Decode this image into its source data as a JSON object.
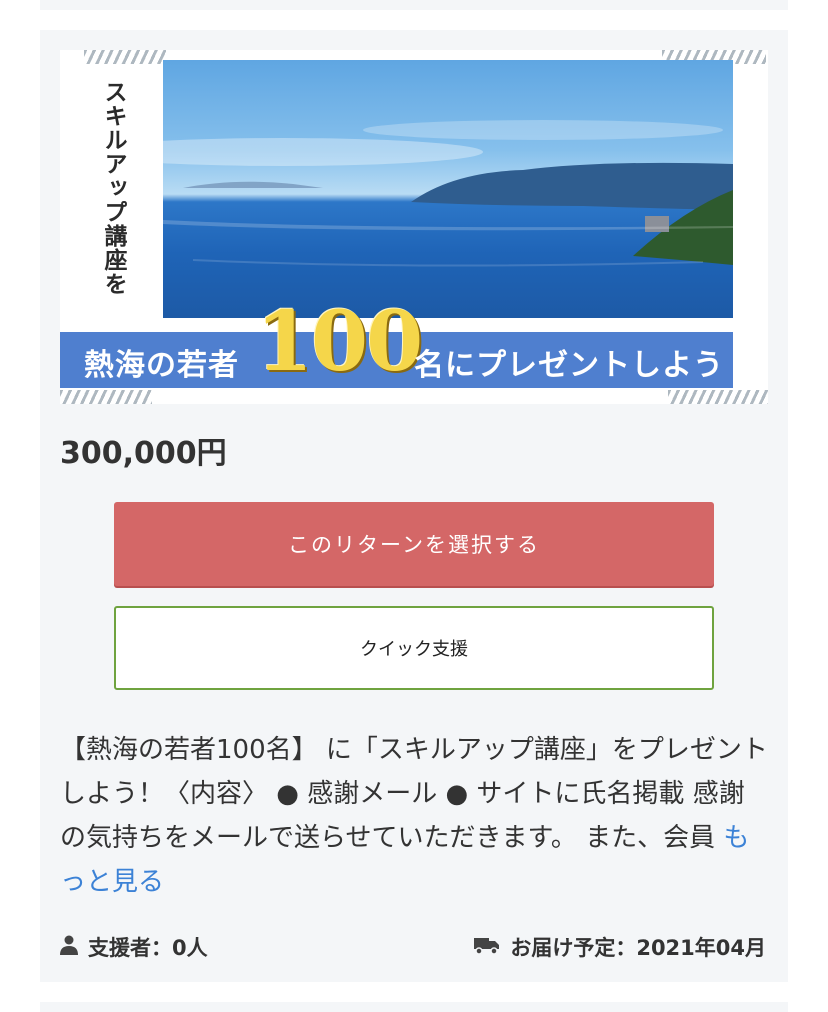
{
  "reward": {
    "banner": {
      "vertical_text": "スキルアップ講座を",
      "bar_left": "熱海の若者",
      "bar_number": "100",
      "bar_right": "名にプレゼントしよう"
    },
    "price": "300,000円",
    "select_button_label": "このリターンを選択する",
    "quick_support_label": "クイック支援",
    "description": "【熱海の若者100名】 に「スキルアップ講座」をプレゼントしよう！〈内容〉 ● 感謝メール ● サイトに氏名掲載 感謝の気持ちをメールで送らせていただきます。 また、会員 ",
    "more_link": "もっと見る",
    "supporters": "支援者：0人",
    "delivery": "お届け予定：2021年04月",
    "icons": {
      "supporters": "user-icon",
      "delivery": "truck-icon"
    },
    "colors": {
      "select_button": "#d46767",
      "quick_border": "#6fa33f",
      "link": "#3c82d6",
      "banner_bar": "#4f7fcf",
      "banner_number": "#f5d64a"
    }
  }
}
